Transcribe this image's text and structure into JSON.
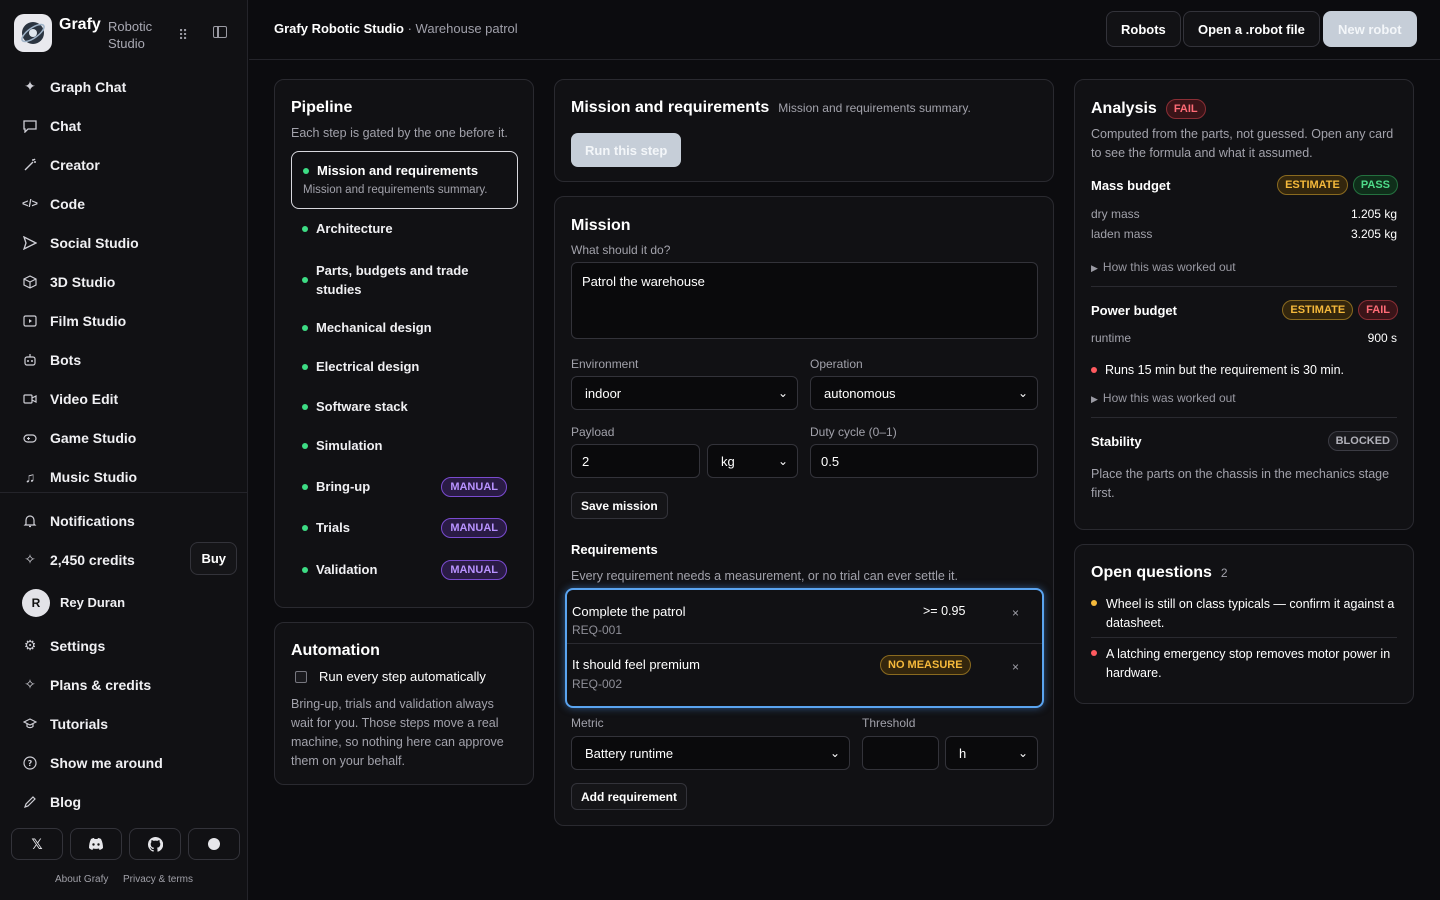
{
  "brand": {
    "name": "Grafy",
    "sub": "Robotic Studio"
  },
  "nav": [
    {
      "label": "Graph Chat",
      "icon": "sparkle-icon"
    },
    {
      "label": "Chat",
      "icon": "chat-icon"
    },
    {
      "label": "Creator",
      "icon": "wand-icon"
    },
    {
      "label": "Code",
      "icon": "code-icon"
    },
    {
      "label": "Social Studio",
      "icon": "send-icon"
    },
    {
      "label": "3D Studio",
      "icon": "cube-icon"
    },
    {
      "label": "Film Studio",
      "icon": "film-icon"
    },
    {
      "label": "Bots",
      "icon": "bot-icon"
    },
    {
      "label": "Video Edit",
      "icon": "video-icon"
    },
    {
      "label": "Game Studio",
      "icon": "gamepad-icon"
    },
    {
      "label": "Music Studio",
      "icon": "music-icon"
    }
  ],
  "account": {
    "notifications": "Notifications",
    "credits": "2,450 credits",
    "buy": "Buy",
    "user_initial": "R",
    "user_name": "Rey Duran"
  },
  "bottom_nav": [
    {
      "label": "Settings",
      "icon": "gear-icon"
    },
    {
      "label": "Plans & credits",
      "icon": "sparkle-icon"
    },
    {
      "label": "Tutorials",
      "icon": "cap-icon"
    },
    {
      "label": "Show me around",
      "icon": "help-icon"
    },
    {
      "label": "Blog",
      "icon": "pen-icon"
    }
  ],
  "footer": {
    "about": "About Grafy",
    "privacy": "Privacy & terms"
  },
  "topbar": {
    "app": "Grafy Robotic Studio",
    "page": " · Warehouse patrol",
    "robots": "Robots",
    "open_file": "Open a .robot file",
    "new_robot": "New robot"
  },
  "pipeline": {
    "title": "Pipeline",
    "subtitle": "Each step is gated by the one before it.",
    "active": {
      "label": "Mission and requirements",
      "summary": "Mission and requirements summary."
    },
    "steps": [
      {
        "label": "Architecture"
      },
      {
        "label": "Parts, budgets and trade studies"
      },
      {
        "label": "Mechanical design"
      },
      {
        "label": "Electrical design"
      },
      {
        "label": "Software stack"
      },
      {
        "label": "Simulation"
      },
      {
        "label": "Bring-up",
        "badge": "MANUAL"
      },
      {
        "label": "Trials",
        "badge": "MANUAL"
      },
      {
        "label": "Validation",
        "badge": "MANUAL"
      }
    ]
  },
  "automation": {
    "title": "Automation",
    "checkbox_label": "Run every step automatically",
    "checked": false,
    "note": "Bring-up, trials and validation always wait for you. Those steps move a real machine, so nothing here can approve them on your behalf."
  },
  "step_header": {
    "title": "Mission and requirements",
    "summary": "Mission and requirements summary.",
    "run": "Run this step"
  },
  "mission": {
    "title": "Mission",
    "prompt": "What should it do?",
    "text": "Patrol the warehouse",
    "env_label": "Environment",
    "env_value": "indoor",
    "op_label": "Operation",
    "op_value": "autonomous",
    "payload_label": "Payload",
    "payload_value": "2",
    "payload_unit": "kg",
    "duty_label": "Duty cycle (0–1)",
    "duty_value": "0.5",
    "save": "Save mission"
  },
  "requirements": {
    "title": "Requirements",
    "note": "Every requirement needs a measurement, or no trial can ever settle it.",
    "items": [
      {
        "title": "Complete the patrol",
        "id": "REQ-001",
        "measure": ">= 0.95",
        "remove": "×"
      },
      {
        "title": "It should feel premium",
        "id": "REQ-002",
        "badge": "NO MEASURE",
        "remove": "×"
      }
    ],
    "metric_label": "Metric",
    "metric_value": "Battery runtime",
    "threshold_label": "Threshold",
    "threshold_value": "",
    "threshold_unit": "h",
    "add": "Add requirement"
  },
  "analysis": {
    "title": "Analysis",
    "status": "FAIL",
    "intro": "Computed from the parts, not guessed. Open any card to see the formula and what it assumed.",
    "mass": {
      "title": "Mass budget",
      "tag": "ESTIMATE",
      "status": "PASS",
      "dry_label": "dry mass",
      "dry_value": "1.205 kg",
      "laden_label": "laden mass",
      "laden_value": "3.205 kg",
      "how": "How this was worked out"
    },
    "power": {
      "title": "Power budget",
      "tag": "ESTIMATE",
      "status": "FAIL",
      "runtime_label": "runtime",
      "runtime_value": "900 s",
      "warning": "Runs 15 min but the requirement is 30 min.",
      "how": "How this was worked out"
    },
    "stability": {
      "title": "Stability",
      "status": "BLOCKED",
      "note": "Place the parts on the chassis in the mechanics stage first."
    }
  },
  "questions": {
    "title": "Open questions",
    "count": "2",
    "items": [
      {
        "text": "Wheel is still on class typicals — confirm it against a datasheet.",
        "color": "#f5b93b"
      },
      {
        "text": "A latching emergency stop removes motor power in hardware.",
        "color": "#ff5a5f"
      }
    ]
  },
  "colors": {
    "accent": "#3ddc84",
    "focus": "#4a90e2",
    "manual": "#b892ff"
  }
}
